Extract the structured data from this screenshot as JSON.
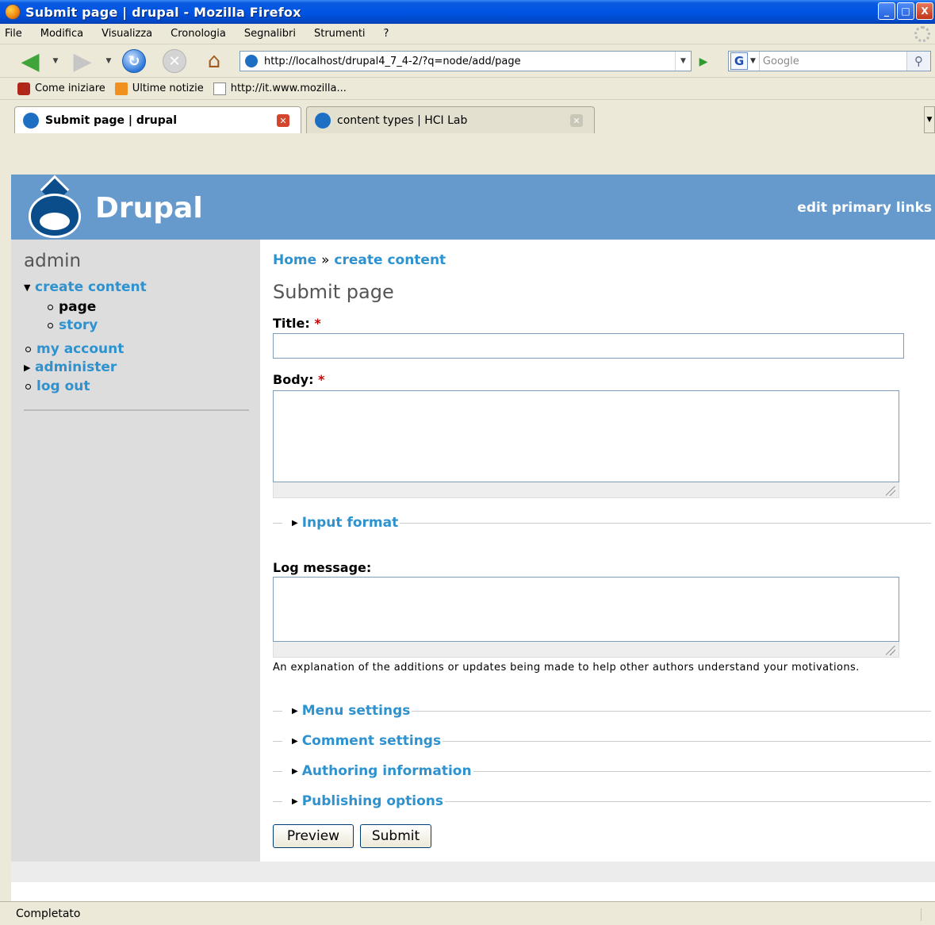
{
  "window": {
    "title": "Submit page | drupal - Mozilla Firefox",
    "controls": [
      "_",
      "□",
      "X"
    ]
  },
  "menubar": [
    "File",
    "Modifica",
    "Visualizza",
    "Cronologia",
    "Segnalibri",
    "Strumenti",
    "?"
  ],
  "navbar": {
    "url": "http://localhost/drupal4_7_4-2/?q=node/add/page",
    "search_placeholder": "Google",
    "search_engine_letter": "G"
  },
  "bookmarks": [
    "Come iniziare",
    "Ultime notizie",
    "http://it.www.mozilla..."
  ],
  "tabs": [
    {
      "label": "Submit page | drupal",
      "active": true
    },
    {
      "label": "content types | HCI Lab",
      "active": false
    }
  ],
  "site": {
    "name": "Drupal",
    "primary_links": "edit primary links"
  },
  "sidebar": {
    "user": "admin",
    "items": [
      {
        "label": "create content",
        "marker": "expanded"
      },
      {
        "label": "page",
        "marker": "sub"
      },
      {
        "label": "story",
        "marker": "sub"
      },
      {
        "label": "my account",
        "marker": "leaf"
      },
      {
        "label": "administer",
        "marker": "collapsed"
      },
      {
        "label": "log out",
        "marker": "leaf"
      }
    ]
  },
  "main": {
    "breadcrumb": {
      "home": "Home",
      "sep": "»",
      "current": "create content"
    },
    "page_title": "Submit page",
    "title_label": "Title:",
    "body_label": "Body:",
    "required_mark": "*",
    "input_format": "Input format",
    "log_label": "Log message:",
    "log_description": "An explanation of the additions or updates being made to help other authors understand your motivations.",
    "fieldsets": [
      "Menu settings",
      "Comment settings",
      "Authoring information",
      "Publishing options"
    ],
    "buttons": {
      "preview": "Preview",
      "submit": "Submit"
    }
  },
  "status": "Completato"
}
